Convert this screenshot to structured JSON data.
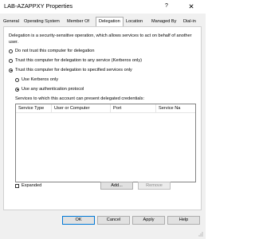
{
  "window": {
    "title": "LAB-AZAPPXY Properties",
    "help_glyph": "?",
    "close_glyph": "✕"
  },
  "tabs": [
    {
      "label": "General"
    },
    {
      "label": "Operating System"
    },
    {
      "label": "Member Of"
    },
    {
      "label": "Delegation",
      "active": true
    },
    {
      "label": "Location"
    },
    {
      "label": "Managed By"
    },
    {
      "label": "Dial-in"
    }
  ],
  "delegation": {
    "description": "Delegation is a security-sensitive operation, which allows services to act on behalf of another user.",
    "options": [
      {
        "label": "Do not trust this computer for delegation",
        "selected": false
      },
      {
        "label": "Trust this computer for delegation to any service (Kerberos only)",
        "selected": false
      },
      {
        "label": "Trust this computer for delegation to specified services only",
        "selected": true
      }
    ],
    "sub_options": [
      {
        "label": "Use Kerberos only",
        "selected": false
      },
      {
        "label": "Use any authentication protocol",
        "selected": true
      }
    ],
    "services_label": "Services to which this account can present delegated credentials:",
    "columns": [
      "Service Type",
      "User or Computer",
      "Port",
      "Service Na"
    ],
    "expanded_label": "Expanded",
    "expanded_checked": false,
    "add_label": "Add...",
    "remove_label": "Remove"
  },
  "footer": {
    "ok_label": "OK",
    "cancel_label": "Cancel",
    "apply_label": "Apply",
    "help_label": "Help"
  },
  "colors": {
    "accent": "#0078d7",
    "dialog_bg": "#f0f0f0",
    "panel_bg": "#ffffff"
  }
}
